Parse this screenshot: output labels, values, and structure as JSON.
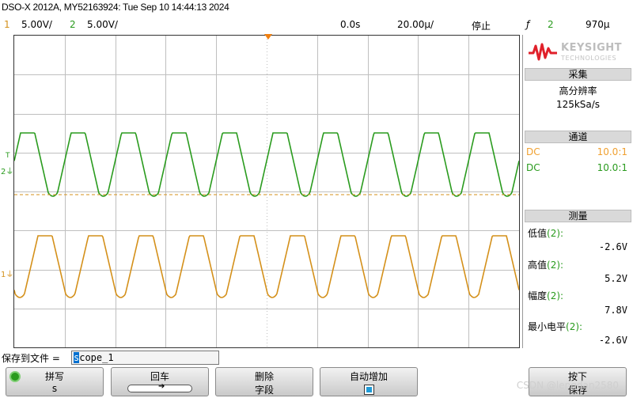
{
  "title": "DSO-X 2012A, MY52163924: Tue Sep 10 14:44:13 2024",
  "status": {
    "ch1_num": "1",
    "ch1_scale": "5.00V/",
    "ch2_num": "2",
    "ch2_scale": "5.00V/",
    "time_offset": "0.0s",
    "time_scale": "20.00µ/",
    "run_state": "停止",
    "trigger_icon": "ƒ",
    "trigger_source": "2",
    "trigger_level": "970µ"
  },
  "colors": {
    "ch1": "#d4901a",
    "ch2": "#2a9b1e",
    "grid": "#bfbfbf",
    "brand": "#e0202a"
  },
  "brand": {
    "name": "KEYSIGHT",
    "sub": "TECHNOLOGIES"
  },
  "acquire": {
    "header": "采集",
    "mode": "高分辨率",
    "rate": "125kSa/s"
  },
  "channels": {
    "header": "通道",
    "rows": [
      {
        "coupling": "DC",
        "probe": "10.0:1"
      },
      {
        "coupling": "DC",
        "probe": "10.0:1"
      }
    ]
  },
  "measure": {
    "header": "测量",
    "items": [
      {
        "label": "低值",
        "src": "(2):",
        "value": "-2.6V"
      },
      {
        "label": "高值",
        "src": "(2):",
        "value": "5.2V"
      },
      {
        "label": "幅度",
        "src": "(2):",
        "value": "7.8V"
      },
      {
        "label": "最小电平",
        "src": "(2):",
        "value": "-2.6V"
      }
    ]
  },
  "save": {
    "label": "保存到文件 =",
    "filename_first": "s",
    "filename_rest": "cope_1"
  },
  "softkeys": {
    "spell": {
      "l1": "拼写",
      "l2": "s"
    },
    "enter": {
      "l1": "回车"
    },
    "delete": {
      "l1": "删除",
      "l2": "字段"
    },
    "autoinc": {
      "l1": "自动增加"
    },
    "press_save": {
      "l1": "按下",
      "l2": "保存"
    }
  },
  "markers": {
    "ch2_marker": "2",
    "ch1_marker": "1",
    "trig_marker": "T"
  },
  "watermark": "CSDN @lengdan2580"
}
